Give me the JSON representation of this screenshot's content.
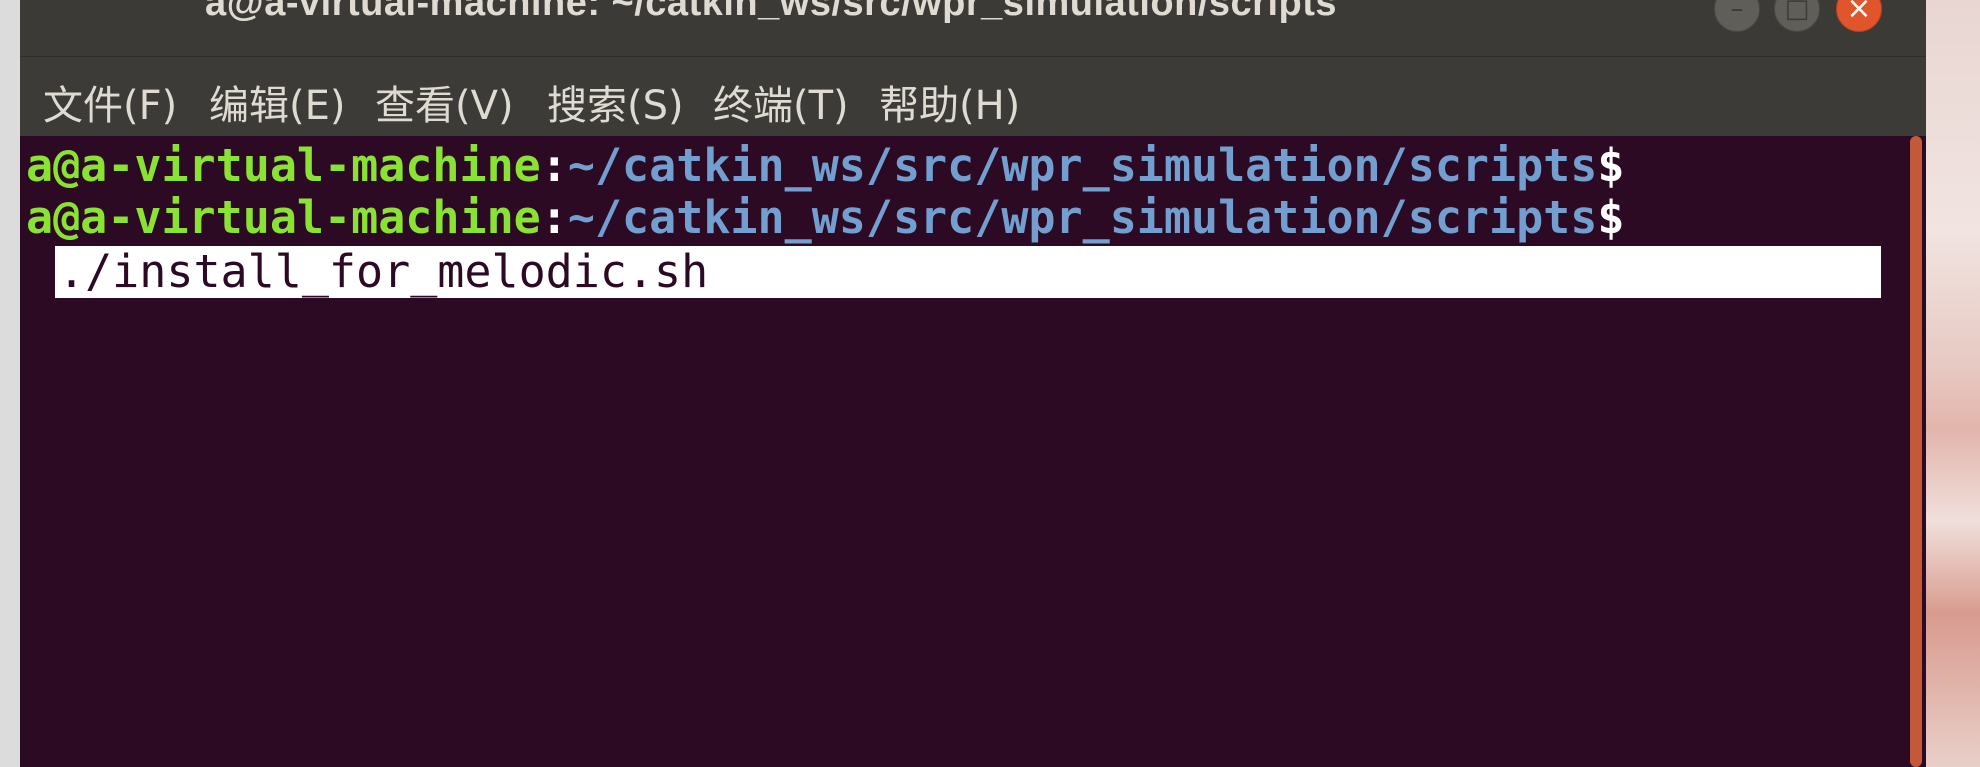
{
  "window": {
    "title": "a@a-virtual-machine: ~/catkin_ws/src/wpr_simulation/scripts",
    "controls": {
      "minimize": "–",
      "maximize": "□",
      "close": "×"
    }
  },
  "menubar": {
    "items": [
      {
        "label": "文件(F)"
      },
      {
        "label": "编辑(E)"
      },
      {
        "label": "查看(V)"
      },
      {
        "label": "搜索(S)"
      },
      {
        "label": "终端(T)"
      },
      {
        "label": "帮助(H)"
      }
    ]
  },
  "terminal": {
    "lines": [
      {
        "user": "a@a-virtual-machine",
        "colon": ":",
        "path": "~/catkin_ws/src/wpr_simulation/scripts",
        "dollar": "$"
      },
      {
        "user": "a@a-virtual-machine",
        "colon": ":",
        "path": "~/catkin_ws/src/wpr_simulation/scripts",
        "dollar": "$"
      }
    ],
    "command": "./install_for_melodic.sh"
  },
  "colors": {
    "terminal_bg": "#2c0a23",
    "prompt_user": "#8ae234",
    "prompt_path": "#729fcf",
    "titlebar_bg": "#3b3a36",
    "close_button": "#e0552c",
    "scrollbar": "#c25a3a"
  }
}
